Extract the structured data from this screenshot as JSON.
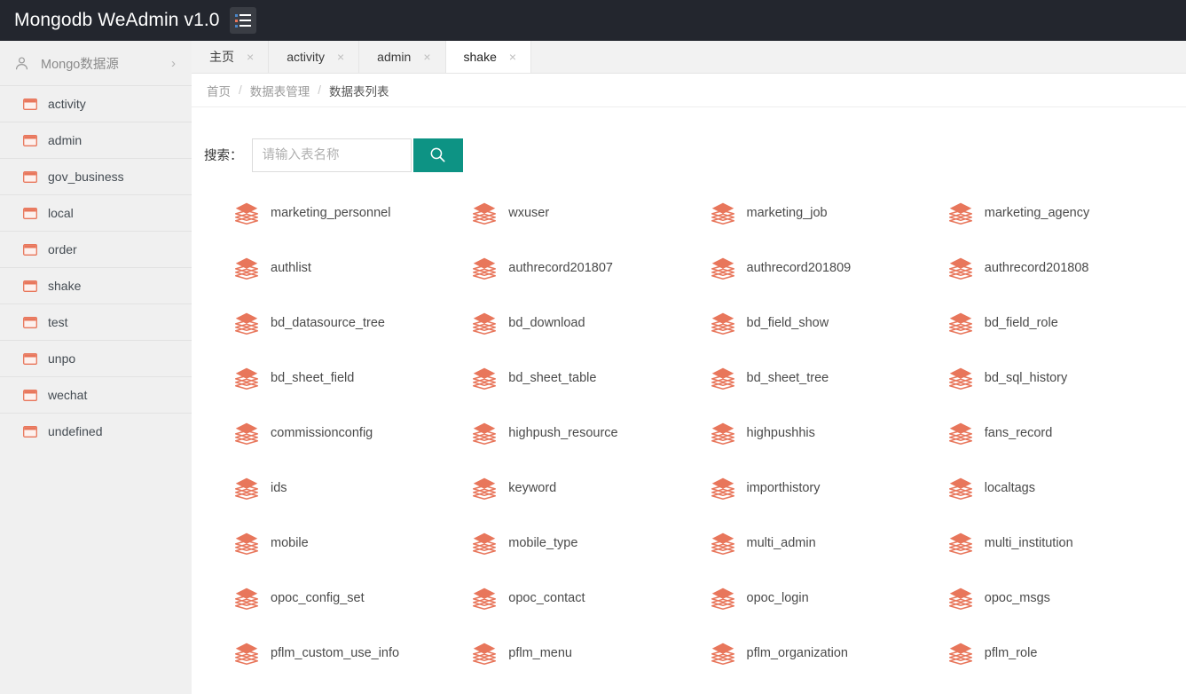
{
  "colors": {
    "header_bg": "#23262e",
    "sidebar_bg": "#f0f0f0",
    "accent_teal": "#0d9384",
    "icon_orange": "#e8765b",
    "tab_bg": "#f2f2f2"
  },
  "header": {
    "title": "Mongodb WeAdmin v1.0",
    "menu_toggle_icon": "list-menu-icon"
  },
  "sidebar": {
    "datasource": {
      "icon": "user-icon",
      "label": "Mongo数据源",
      "chevron": "›"
    },
    "databases": [
      {
        "label": "activity",
        "icon": "database-icon"
      },
      {
        "label": "admin",
        "icon": "database-icon"
      },
      {
        "label": "gov_business",
        "icon": "database-icon"
      },
      {
        "label": "local",
        "icon": "database-icon"
      },
      {
        "label": "order",
        "icon": "database-icon"
      },
      {
        "label": "shake",
        "icon": "database-icon"
      },
      {
        "label": "test",
        "icon": "database-icon"
      },
      {
        "label": "unpo",
        "icon": "database-icon"
      },
      {
        "label": "wechat",
        "icon": "database-icon"
      },
      {
        "label": "undefined",
        "icon": "database-icon"
      }
    ]
  },
  "tabs": [
    {
      "label": "主页",
      "active": false,
      "close": "×"
    },
    {
      "label": "activity",
      "active": false,
      "close": "×"
    },
    {
      "label": "admin",
      "active": false,
      "close": "×"
    },
    {
      "label": "shake",
      "active": true,
      "close": "×"
    }
  ],
  "breadcrumb": {
    "separator": "/",
    "items": [
      {
        "label": "首页",
        "current": false
      },
      {
        "label": "数据表管理",
        "current": false
      },
      {
        "label": "数据表列表",
        "current": true
      }
    ]
  },
  "search": {
    "label": "搜索：",
    "value": "",
    "placeholder": "请输入表名称",
    "button_icon": "search-icon"
  },
  "tables": [
    "marketing_personnel",
    "wxuser",
    "marketing_job",
    "marketing_agency",
    "authlist",
    "authrecord201807",
    "authrecord201809",
    "authrecord201808",
    "bd_datasource_tree",
    "bd_download",
    "bd_field_show",
    "bd_field_role",
    "bd_sheet_field",
    "bd_sheet_table",
    "bd_sheet_tree",
    "bd_sql_history",
    "commissionconfig",
    "highpush_resource",
    "highpushhis",
    "fans_record",
    "ids",
    "keyword",
    "importhistory",
    "localtags",
    "mobile",
    "mobile_type",
    "multi_admin",
    "multi_institution",
    "opoc_config_set",
    "opoc_contact",
    "opoc_login",
    "opoc_msgs",
    "pflm_custom_use_info",
    "pflm_menu",
    "pflm_organization",
    "pflm_role"
  ]
}
